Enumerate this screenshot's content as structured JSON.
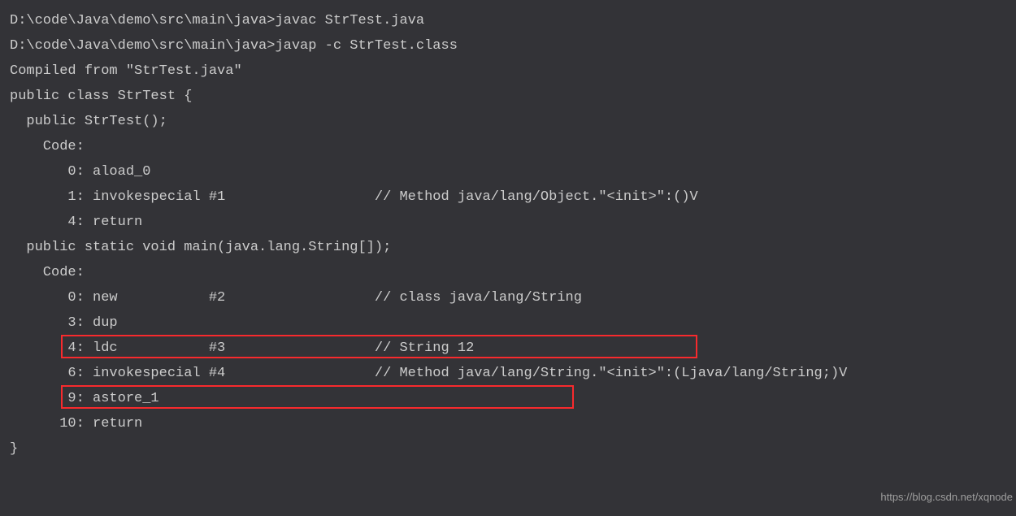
{
  "lines": {
    "l01": "D:\\code\\Java\\demo\\src\\main\\java>javac StrTest.java",
    "l02": "D:\\code\\Java\\demo\\src\\main\\java>javap -c StrTest.class",
    "l03": "Compiled from \"StrTest.java\"",
    "l04": "public class StrTest {",
    "l05": "  public StrTest();",
    "l06": "    Code:",
    "l07": "       0: aload_0",
    "l08": "       1: invokespecial #1                  // Method java/lang/Object.\"<init>\":()V",
    "l09": "       4: return",
    "l10": "  public static void main(java.lang.String[]);",
    "l11": "    Code:",
    "l12": "       0: new           #2                  // class java/lang/String",
    "l13": "       3: dup",
    "l14": "       4: ldc           #3                  // String 12",
    "l15": "       6: invokespecial #4                  // Method java/lang/String.\"<init>\":(Ljava/lang/String;)V",
    "l16": "       9: astore_1",
    "l17": "      10: return",
    "l18": "}"
  },
  "watermark": "https://blog.csdn.net/xqnode"
}
